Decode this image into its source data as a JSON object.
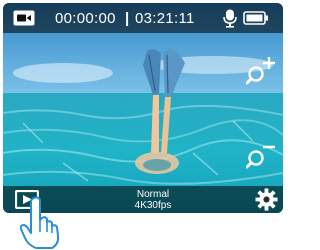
{
  "status_bar": {
    "recorded_time": "00:00:00",
    "separator": "|",
    "remaining_time": "03:21:11",
    "mode_icon": "video-camera-icon",
    "mic_icon": "microphone-icon",
    "battery_icon": "battery-icon"
  },
  "controls": {
    "zoom_in_icon": "zoom-in-icon",
    "zoom_out_icon": "zoom-out-icon",
    "playback_icon": "playback-icon",
    "settings_icon": "gear-icon"
  },
  "video_mode": {
    "name": "Normal",
    "resolution": "4K30fps"
  },
  "gesture_hint": "pointing-hand-icon"
}
